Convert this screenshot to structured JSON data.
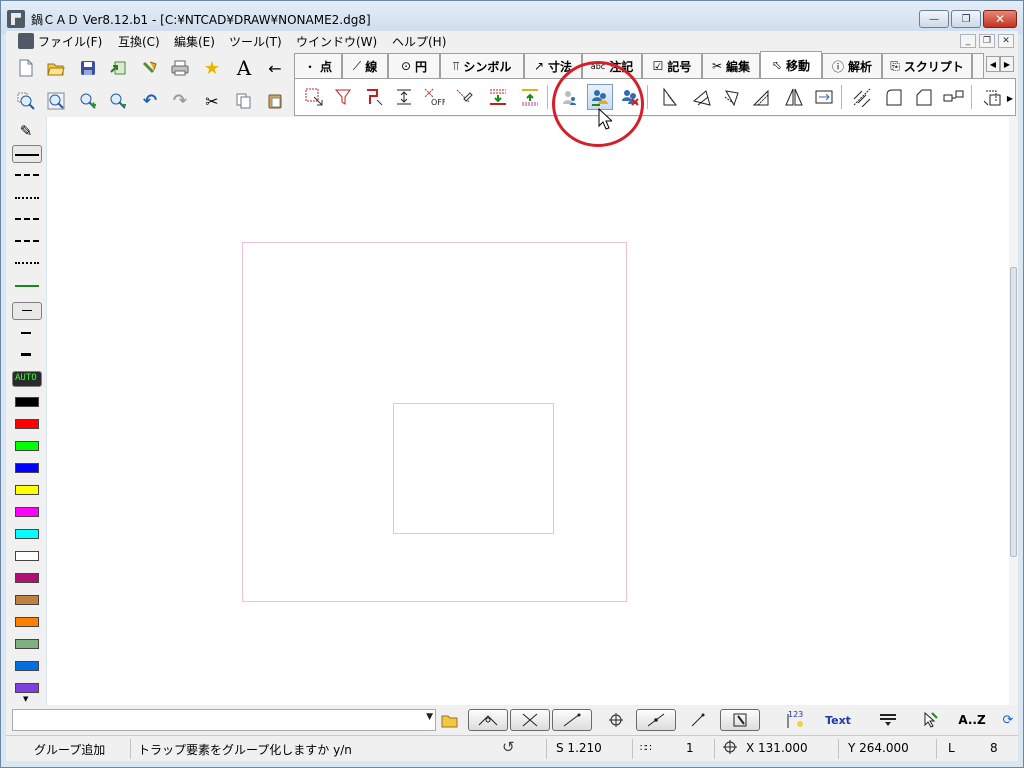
{
  "window": {
    "title": "鍋ＣＡＤ Ver8.12.b1 - [C:¥NTCAD¥DRAW¥NONAME2.dg8]",
    "minimize": "—",
    "maximize": "❐",
    "close": "✕"
  },
  "menu": {
    "items": [
      "ファイル(F)",
      "互換(C)",
      "編集(E)",
      "ツール(T)",
      "ウインドウ(W)",
      "ヘルプ(H)"
    ],
    "mdi_minimize": "_",
    "mdi_restore": "❐",
    "mdi_close": "✕"
  },
  "tabs": [
    {
      "icon": "・",
      "label": "点"
    },
    {
      "icon": "⟋",
      "label": "線"
    },
    {
      "icon": "⊙",
      "label": "円"
    },
    {
      "icon": "⫪",
      "label": "シンボル"
    },
    {
      "icon": "↗",
      "label": "寸法"
    },
    {
      "icon": "abc",
      "label": "注記"
    },
    {
      "icon": "☑",
      "label": "記号"
    },
    {
      "icon": "✂",
      "label": "編集"
    },
    {
      "icon": "⬁",
      "label": "移動",
      "active": true
    },
    {
      "icon": "ⓘ",
      "label": "解析"
    },
    {
      "icon": "⎘",
      "label": "スクリプト"
    }
  ],
  "palette": {
    "auto_label": "AUTO",
    "colors": [
      "#000000",
      "#ff0000",
      "#00ff00",
      "#0000ff",
      "#ffff00",
      "#ff00ff",
      "#00ffff",
      "#ffffff",
      "#b01070",
      "#c08040",
      "#ff8000",
      "#80b080",
      "#0070e0",
      "#8040e0"
    ]
  },
  "bottom": {
    "combo_value": "",
    "text_button": "Text",
    "sort_button": "A..Z",
    "number_button": "123"
  },
  "status": {
    "mode": "グループ追加",
    "prompt": "トラップ要素をグループ化しますか y/n",
    "scale": "S 1.210",
    "layer": "1",
    "x": "X 131.000",
    "y": "Y 264.000",
    "l_label": "L",
    "l_value": "8"
  }
}
